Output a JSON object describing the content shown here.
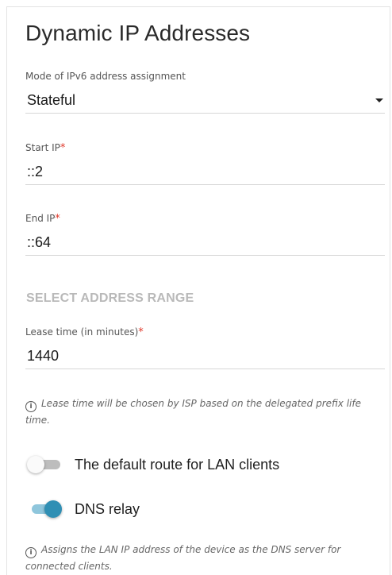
{
  "page": {
    "title": "Dynamic IP Addresses"
  },
  "mode": {
    "label": "Mode of IPv6 address assignment",
    "value": "Stateful"
  },
  "start_ip": {
    "label": "Start IP",
    "required_mark": "*",
    "value": "::2"
  },
  "end_ip": {
    "label": "End IP",
    "required_mark": "*",
    "value": "::64"
  },
  "select_range": {
    "label": "SELECT ADDRESS RANGE"
  },
  "lease": {
    "label": "Lease time (in minutes)",
    "required_mark": "*",
    "value": "1440",
    "hint": "Lease time will be chosen by ISP based on the delegated prefix life time."
  },
  "default_route": {
    "label": "The default route for LAN clients",
    "enabled": false
  },
  "dns_relay": {
    "label": "DNS relay",
    "enabled": true,
    "hint": "Assigns the LAN IP address of the device as the DNS server for connected clients."
  },
  "icons": {
    "info": "info-icon",
    "dropdown": "chevron-down-icon"
  },
  "colors": {
    "accent": "#2f8fb4",
    "required": "#e0392b",
    "disabled_link": "#b9b9b9"
  }
}
